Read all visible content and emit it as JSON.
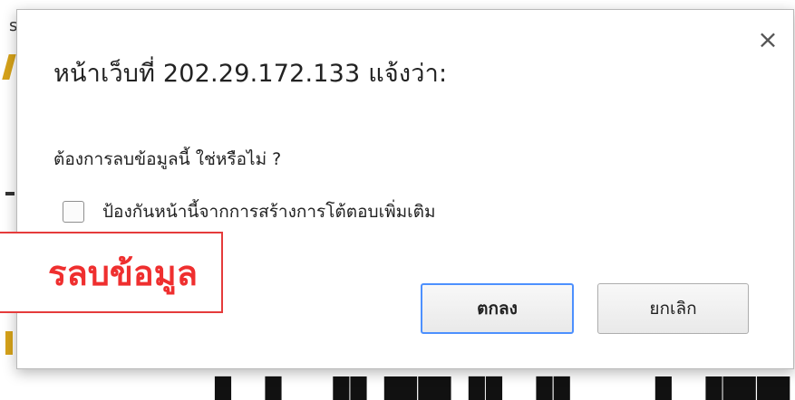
{
  "dialog": {
    "title": "หน้าเว็บที่ 202.29.172.133 แจ้งว่า:",
    "message": "ต้องการลบข้อมูลนี้ ใช่หรือไม่ ?",
    "prevent_label": "ป้องกันหน้านี้จากการสร้างการโต้ตอบเพิ่มเติม",
    "prevent_checked": false,
    "close_icon": "×",
    "ok_label": "ตกลง",
    "cancel_label": "ยกเลิก",
    "focus_color": "#4d90fe"
  },
  "annotation": {
    "text": "รลบข้อมูล",
    "color": "#ef2f2f"
  },
  "background": {
    "corner_letter": "s"
  }
}
